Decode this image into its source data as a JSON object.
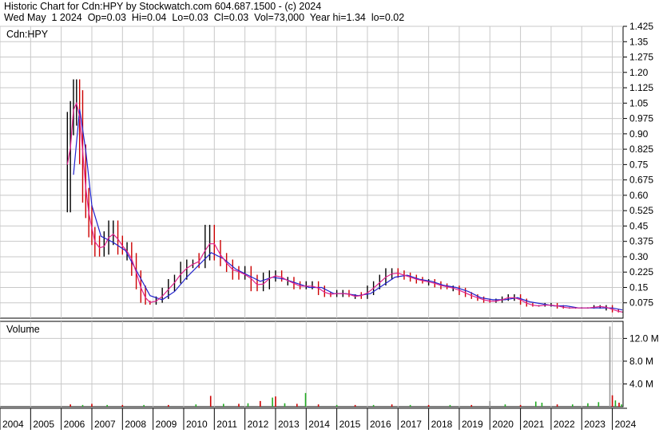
{
  "header": {
    "line1": "Historic Chart for Cdn:HPY by Stockwatch.com 604.687.1500 - (c) 2024",
    "line2": "Wed May  1 2024  Op=0.03  Hi=0.04  Lo=0.03  Cl=0.03  Vol=73,000  Year hi=1.34  lo=0.02"
  },
  "chart_data": [
    {
      "type": "line",
      "panel_label": "Cdn:HPY",
      "y_ticks": [
        "1.425",
        "1.35",
        "1.275",
        "1.20",
        "1.125",
        "1.05",
        "0.975",
        "0.90",
        "0.825",
        "0.75",
        "0.675",
        "0.60",
        "0.525",
        "0.45",
        "0.375",
        "0.30",
        "0.225",
        "0.15",
        "0.075"
      ],
      "ylim": [
        0,
        1.425
      ],
      "grid": true,
      "x_ticks": [
        "2004",
        "2005",
        "2006",
        "2007",
        "2008",
        "2009",
        "2010",
        "2011",
        "2012",
        "2013",
        "2014",
        "2015",
        "2016",
        "2017",
        "2018",
        "2019",
        "2020",
        "2021",
        "2022",
        "2023",
        "2024"
      ],
      "xlim": [
        2004.0,
        2024.35
      ],
      "price_points": [
        {
          "x": 2006.2,
          "y": 0.55
        },
        {
          "x": 2006.3,
          "y": 0.95
        },
        {
          "x": 2006.4,
          "y": 1.0
        },
        {
          "x": 2006.5,
          "y": 1.1
        },
        {
          "x": 2006.6,
          "y": 1.05
        },
        {
          "x": 2006.7,
          "y": 0.8
        },
        {
          "x": 2006.8,
          "y": 0.6
        },
        {
          "x": 2006.9,
          "y": 0.52
        },
        {
          "x": 2007.0,
          "y": 0.42
        },
        {
          "x": 2007.1,
          "y": 0.38
        },
        {
          "x": 2007.25,
          "y": 0.32
        },
        {
          "x": 2007.4,
          "y": 0.33
        },
        {
          "x": 2007.55,
          "y": 0.4
        },
        {
          "x": 2007.7,
          "y": 0.45
        },
        {
          "x": 2007.85,
          "y": 0.38
        },
        {
          "x": 2008.0,
          "y": 0.33
        },
        {
          "x": 2008.15,
          "y": 0.35
        },
        {
          "x": 2008.3,
          "y": 0.3
        },
        {
          "x": 2008.45,
          "y": 0.22
        },
        {
          "x": 2008.6,
          "y": 0.15
        },
        {
          "x": 2008.75,
          "y": 0.08
        },
        {
          "x": 2008.9,
          "y": 0.07
        },
        {
          "x": 2009.1,
          "y": 0.08
        },
        {
          "x": 2009.3,
          "y": 0.1
        },
        {
          "x": 2009.5,
          "y": 0.14
        },
        {
          "x": 2009.7,
          "y": 0.18
        },
        {
          "x": 2009.9,
          "y": 0.2
        },
        {
          "x": 2010.1,
          "y": 0.26
        },
        {
          "x": 2010.3,
          "y": 0.27
        },
        {
          "x": 2010.5,
          "y": 0.26
        },
        {
          "x": 2010.7,
          "y": 0.3
        },
        {
          "x": 2010.85,
          "y": 0.43
        },
        {
          "x": 2011.0,
          "y": 0.36
        },
        {
          "x": 2011.2,
          "y": 0.3
        },
        {
          "x": 2011.4,
          "y": 0.27
        },
        {
          "x": 2011.6,
          "y": 0.24
        },
        {
          "x": 2011.8,
          "y": 0.2
        },
        {
          "x": 2012.0,
          "y": 0.24
        },
        {
          "x": 2012.2,
          "y": 0.2
        },
        {
          "x": 2012.4,
          "y": 0.14
        },
        {
          "x": 2012.6,
          "y": 0.15
        },
        {
          "x": 2012.8,
          "y": 0.21
        },
        {
          "x": 2013.0,
          "y": 0.22
        },
        {
          "x": 2013.2,
          "y": 0.19
        },
        {
          "x": 2013.4,
          "y": 0.19
        },
        {
          "x": 2013.6,
          "y": 0.17
        },
        {
          "x": 2013.8,
          "y": 0.15
        },
        {
          "x": 2014.0,
          "y": 0.15
        },
        {
          "x": 2014.2,
          "y": 0.17
        },
        {
          "x": 2014.4,
          "y": 0.15
        },
        {
          "x": 2014.6,
          "y": 0.12
        },
        {
          "x": 2014.8,
          "y": 0.11
        },
        {
          "x": 2015.0,
          "y": 0.12
        },
        {
          "x": 2015.2,
          "y": 0.13
        },
        {
          "x": 2015.4,
          "y": 0.11
        },
        {
          "x": 2015.6,
          "y": 0.11
        },
        {
          "x": 2015.8,
          "y": 0.1
        },
        {
          "x": 2016.0,
          "y": 0.12
        },
        {
          "x": 2016.2,
          "y": 0.15
        },
        {
          "x": 2016.4,
          "y": 0.17
        },
        {
          "x": 2016.6,
          "y": 0.2
        },
        {
          "x": 2016.8,
          "y": 0.23
        },
        {
          "x": 2017.0,
          "y": 0.22
        },
        {
          "x": 2017.2,
          "y": 0.21
        },
        {
          "x": 2017.4,
          "y": 0.2
        },
        {
          "x": 2017.6,
          "y": 0.19
        },
        {
          "x": 2017.8,
          "y": 0.18
        },
        {
          "x": 2018.0,
          "y": 0.18
        },
        {
          "x": 2018.2,
          "y": 0.17
        },
        {
          "x": 2018.4,
          "y": 0.16
        },
        {
          "x": 2018.6,
          "y": 0.15
        },
        {
          "x": 2018.8,
          "y": 0.15
        },
        {
          "x": 2019.0,
          "y": 0.14
        },
        {
          "x": 2019.2,
          "y": 0.12
        },
        {
          "x": 2019.4,
          "y": 0.11
        },
        {
          "x": 2019.6,
          "y": 0.1
        },
        {
          "x": 2019.8,
          "y": 0.09
        },
        {
          "x": 2020.0,
          "y": 0.08
        },
        {
          "x": 2020.2,
          "y": 0.08
        },
        {
          "x": 2020.4,
          "y": 0.09
        },
        {
          "x": 2020.6,
          "y": 0.1
        },
        {
          "x": 2020.8,
          "y": 0.11
        },
        {
          "x": 2021.0,
          "y": 0.09
        },
        {
          "x": 2021.2,
          "y": 0.07
        },
        {
          "x": 2021.4,
          "y": 0.06
        },
        {
          "x": 2021.6,
          "y": 0.06
        },
        {
          "x": 2021.8,
          "y": 0.06
        },
        {
          "x": 2022.0,
          "y": 0.07
        },
        {
          "x": 2022.2,
          "y": 0.06
        },
        {
          "x": 2022.4,
          "y": 0.05
        },
        {
          "x": 2022.6,
          "y": 0.05
        },
        {
          "x": 2022.8,
          "y": 0.05
        },
        {
          "x": 2023.0,
          "y": 0.05
        },
        {
          "x": 2023.2,
          "y": 0.05
        },
        {
          "x": 2023.4,
          "y": 0.05
        },
        {
          "x": 2023.6,
          "y": 0.06
        },
        {
          "x": 2023.8,
          "y": 0.06
        },
        {
          "x": 2024.0,
          "y": 0.04
        },
        {
          "x": 2024.2,
          "y": 0.03
        },
        {
          "x": 2024.33,
          "y": 0.03
        }
      ],
      "ma_slow_points": [
        {
          "x": 2006.4,
          "y": 0.7
        },
        {
          "x": 2006.6,
          "y": 1.02
        },
        {
          "x": 2006.8,
          "y": 0.82
        },
        {
          "x": 2007.0,
          "y": 0.55
        },
        {
          "x": 2007.3,
          "y": 0.4
        },
        {
          "x": 2007.7,
          "y": 0.37
        },
        {
          "x": 2008.1,
          "y": 0.33
        },
        {
          "x": 2008.5,
          "y": 0.22
        },
        {
          "x": 2008.9,
          "y": 0.11
        },
        {
          "x": 2009.3,
          "y": 0.09
        },
        {
          "x": 2009.7,
          "y": 0.13
        },
        {
          "x": 2010.1,
          "y": 0.2
        },
        {
          "x": 2010.5,
          "y": 0.26
        },
        {
          "x": 2010.9,
          "y": 0.32
        },
        {
          "x": 2011.3,
          "y": 0.29
        },
        {
          "x": 2011.7,
          "y": 0.24
        },
        {
          "x": 2012.1,
          "y": 0.21
        },
        {
          "x": 2012.5,
          "y": 0.18
        },
        {
          "x": 2012.9,
          "y": 0.2
        },
        {
          "x": 2013.3,
          "y": 0.19
        },
        {
          "x": 2013.7,
          "y": 0.17
        },
        {
          "x": 2014.1,
          "y": 0.15
        },
        {
          "x": 2014.5,
          "y": 0.15
        },
        {
          "x": 2014.9,
          "y": 0.12
        },
        {
          "x": 2015.3,
          "y": 0.12
        },
        {
          "x": 2015.7,
          "y": 0.11
        },
        {
          "x": 2016.1,
          "y": 0.12
        },
        {
          "x": 2016.5,
          "y": 0.16
        },
        {
          "x": 2016.9,
          "y": 0.2
        },
        {
          "x": 2017.3,
          "y": 0.21
        },
        {
          "x": 2017.7,
          "y": 0.19
        },
        {
          "x": 2018.1,
          "y": 0.18
        },
        {
          "x": 2018.5,
          "y": 0.16
        },
        {
          "x": 2018.9,
          "y": 0.15
        },
        {
          "x": 2019.3,
          "y": 0.13
        },
        {
          "x": 2019.7,
          "y": 0.1
        },
        {
          "x": 2020.1,
          "y": 0.09
        },
        {
          "x": 2020.5,
          "y": 0.09
        },
        {
          "x": 2020.9,
          "y": 0.1
        },
        {
          "x": 2021.3,
          "y": 0.08
        },
        {
          "x": 2021.7,
          "y": 0.07
        },
        {
          "x": 2022.1,
          "y": 0.06
        },
        {
          "x": 2022.5,
          "y": 0.06
        },
        {
          "x": 2022.9,
          "y": 0.05
        },
        {
          "x": 2023.3,
          "y": 0.05
        },
        {
          "x": 2023.7,
          "y": 0.05
        },
        {
          "x": 2024.0,
          "y": 0.05
        },
        {
          "x": 2024.33,
          "y": 0.04
        }
      ],
      "colors": {
        "price": "#000000",
        "ma_fast": "#e0208c",
        "ma_slow": "#2222cc",
        "down_tick": "#cc0000",
        "grid": "#c8c8c8",
        "frame": "#000000"
      }
    },
    {
      "type": "bar",
      "panel_label": "Volume",
      "y_ticks": [
        "12.0 M",
        "8.0 M",
        "4.0 M"
      ],
      "ylim": [
        0,
        15.0
      ],
      "grid": true,
      "volume_points": [
        {
          "x": 2006.3,
          "y": 0.4,
          "c": "r"
        },
        {
          "x": 2006.7,
          "y": 0.3,
          "c": "g"
        },
        {
          "x": 2007.0,
          "y": 0.5,
          "c": "r"
        },
        {
          "x": 2007.5,
          "y": 0.3,
          "c": "g"
        },
        {
          "x": 2008.0,
          "y": 0.3,
          "c": "r"
        },
        {
          "x": 2008.7,
          "y": 0.3,
          "c": "g"
        },
        {
          "x": 2009.5,
          "y": 0.3,
          "c": "r"
        },
        {
          "x": 2010.4,
          "y": 0.4,
          "c": "g"
        },
        {
          "x": 2010.88,
          "y": 1.9,
          "c": "r"
        },
        {
          "x": 2011.3,
          "y": 0.5,
          "c": "g"
        },
        {
          "x": 2011.8,
          "y": 0.5,
          "c": "r"
        },
        {
          "x": 2012.1,
          "y": 0.6,
          "c": "g"
        },
        {
          "x": 2012.5,
          "y": 1.0,
          "c": "r"
        },
        {
          "x": 2012.9,
          "y": 1.6,
          "c": "g"
        },
        {
          "x": 2013.0,
          "y": 1.8,
          "c": "r"
        },
        {
          "x": 2013.3,
          "y": 0.6,
          "c": "g"
        },
        {
          "x": 2013.7,
          "y": 0.5,
          "c": "r"
        },
        {
          "x": 2013.98,
          "y": 2.4,
          "c": "g"
        },
        {
          "x": 2014.4,
          "y": 0.4,
          "c": "r"
        },
        {
          "x": 2015.0,
          "y": 0.3,
          "c": "g"
        },
        {
          "x": 2015.6,
          "y": 0.3,
          "c": "r"
        },
        {
          "x": 2016.2,
          "y": 0.3,
          "c": "g"
        },
        {
          "x": 2016.8,
          "y": 0.4,
          "c": "r"
        },
        {
          "x": 2017.4,
          "y": 0.3,
          "c": "g"
        },
        {
          "x": 2018.0,
          "y": 0.3,
          "c": "r"
        },
        {
          "x": 2018.7,
          "y": 0.3,
          "c": "g"
        },
        {
          "x": 2019.4,
          "y": 0.3,
          "c": "r"
        },
        {
          "x": 2020.0,
          "y": 1.0,
          "c": "x"
        },
        {
          "x": 2020.5,
          "y": 0.4,
          "c": "g"
        },
        {
          "x": 2021.0,
          "y": 0.3,
          "c": "r"
        },
        {
          "x": 2021.5,
          "y": 0.9,
          "c": "g"
        },
        {
          "x": 2021.7,
          "y": 0.7,
          "c": "g"
        },
        {
          "x": 2022.2,
          "y": 0.4,
          "c": "r"
        },
        {
          "x": 2022.7,
          "y": 0.4,
          "c": "g"
        },
        {
          "x": 2023.2,
          "y": 0.6,
          "c": "g"
        },
        {
          "x": 2023.55,
          "y": 0.8,
          "c": "g"
        },
        {
          "x": 2023.92,
          "y": 14.1,
          "c": "x"
        },
        {
          "x": 2024.0,
          "y": 2.0,
          "c": "r"
        },
        {
          "x": 2024.1,
          "y": 1.1,
          "c": "g"
        },
        {
          "x": 2024.22,
          "y": 0.7,
          "c": "r"
        },
        {
          "x": 2024.3,
          "y": 0.4,
          "c": "g"
        }
      ],
      "colors": {
        "r": "#cc0000",
        "g": "#22aa22",
        "x": "#999999"
      }
    }
  ]
}
